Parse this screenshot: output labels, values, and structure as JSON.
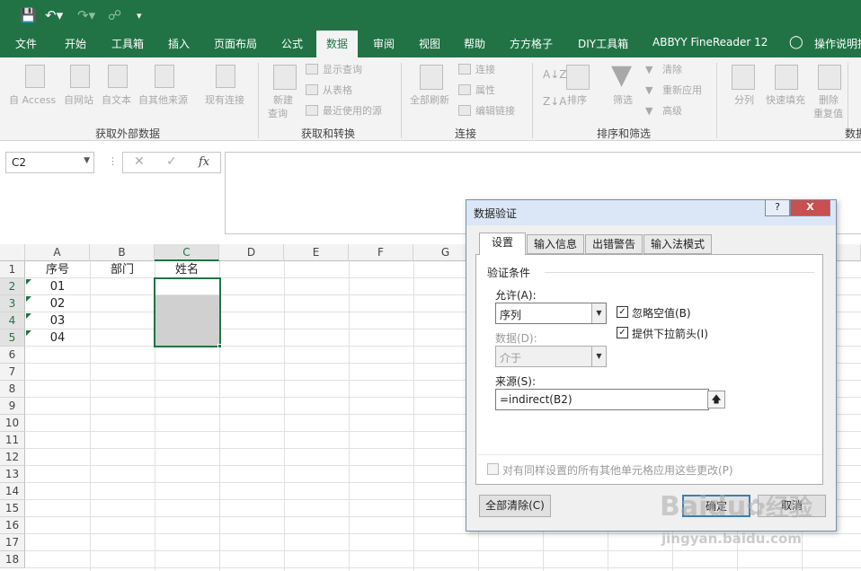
{
  "quick_access": {
    "save_icon": "save-icon",
    "undo_icon": "undo-icon",
    "redo_icon": "redo-icon",
    "preview_icon": "print-preview-icon",
    "more_icon": "customize-icon"
  },
  "tabs": [
    "文件",
    "开始",
    "工具箱",
    "插入",
    "页面布局",
    "公式",
    "数据",
    "审阅",
    "视图",
    "帮助",
    "方方格子",
    "DIY工具箱",
    "ABBYY FineReader 12",
    "操作说明搜"
  ],
  "active_tab": "数据",
  "ribbon": {
    "get_external": {
      "label": "获取外部数据",
      "items": [
        "自 Access",
        "自网站",
        "自文本",
        "自其他来源",
        "现有连接"
      ]
    },
    "get_transform": {
      "label": "获取和转换",
      "new_query": "新建",
      "new_query2": "查询",
      "show_query": "显示查询",
      "from_table": "从表格",
      "recent_sources": "最近使用的源"
    },
    "connections": {
      "label": "连接",
      "refresh_all": "全部刷新",
      "connections": "连接",
      "properties": "属性",
      "edit_links": "编辑链接"
    },
    "sort_filter": {
      "label": "排序和筛选",
      "sort": "排序",
      "filter": "筛选",
      "clear": "清除",
      "reapply": "重新应用",
      "advanced": "高级"
    },
    "data_tools": {
      "label": "数据",
      "split": "分列",
      "flash_fill": "快速填充",
      "remove_dup": "删除",
      "remove_dup2": "重复值"
    }
  },
  "formula_bar": {
    "name_box": "C2",
    "fx": "fx",
    "content": ""
  },
  "columns": [
    "A",
    "B",
    "C",
    "D",
    "E",
    "F",
    "G"
  ],
  "rows": [
    "1",
    "2",
    "3",
    "4",
    "5",
    "6",
    "7",
    "8",
    "9",
    "10",
    "11",
    "12",
    "13",
    "14",
    "15",
    "16",
    "17",
    "18"
  ],
  "cells": {
    "A1": "序号",
    "B1": "部门",
    "C1": "姓名",
    "A2": "01",
    "A3": "02",
    "A4": "03",
    "A5": "04"
  },
  "dialog": {
    "title": "数据验证",
    "help": "?",
    "close": "X",
    "tabs": [
      "设置",
      "输入信息",
      "出错警告",
      "输入法模式"
    ],
    "criteria_label": "验证条件",
    "allow_label": "允许(A):",
    "allow_value": "序列",
    "data_label": "数据(D):",
    "data_value": "介于",
    "ignore_blank": "忽略空值(B)",
    "in_cell_dropdown": "提供下拉箭头(I)",
    "source_label": "来源(S):",
    "source_value": "=indirect(B2)",
    "apply_all": "对有同样设置的所有其他单元格应用这些更改(P)",
    "clear_all": "全部清除(C)",
    "ok": "确定",
    "cancel": "取消"
  },
  "watermark": {
    "brand": "Baidu",
    "brand2": "经验",
    "url": "jingyan.baidu.com"
  }
}
